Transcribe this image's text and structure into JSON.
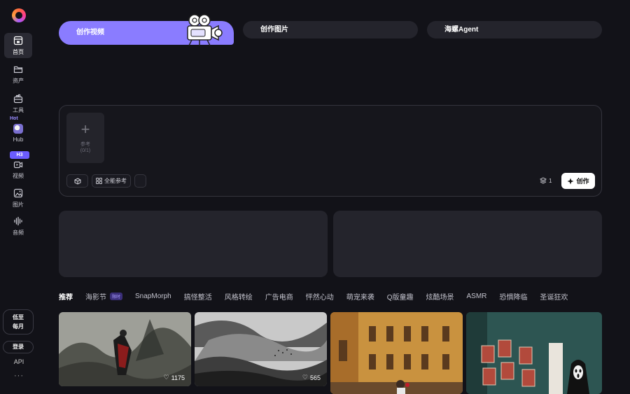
{
  "sidebar": {
    "items": [
      {
        "label": "首页",
        "icon": "home-icon"
      },
      {
        "label": "资产",
        "icon": "folder-icon"
      },
      {
        "label": "工具",
        "icon": "toolbox-icon"
      },
      {
        "label": "Hub",
        "icon": "hub-avatar-icon",
        "badge": "Hot"
      },
      {
        "label": "视频",
        "icon": "video-icon",
        "badge": "H3"
      },
      {
        "label": "图片",
        "icon": "image-icon"
      },
      {
        "label": "音频",
        "icon": "audio-icon"
      }
    ],
    "promo_line1": "低至",
    "promo_line2": "每月",
    "login": "登录",
    "api": "API",
    "more": "···"
  },
  "modes": {
    "video": "创作视频",
    "image": "创作图片",
    "agent": "海螺Agent"
  },
  "prompt": {
    "ref_label": "参考",
    "ref_count": "(0/1)",
    "omni_ref": "全能参考",
    "count": "1",
    "create": "创作"
  },
  "categories": [
    {
      "label": "推荐",
      "active": true
    },
    {
      "label": "海影节",
      "badge": "限时"
    },
    {
      "label": "SnapMorph"
    },
    {
      "label": "搞怪整活"
    },
    {
      "label": "风格转绘"
    },
    {
      "label": "广告电商"
    },
    {
      "label": "怦然心动"
    },
    {
      "label": "萌宠来袭"
    },
    {
      "label": "Q版童趣"
    },
    {
      "label": "炫酷场景"
    },
    {
      "label": "ASMR"
    },
    {
      "label": "恐惧降临"
    },
    {
      "label": "圣诞狂欢"
    }
  ],
  "gallery": [
    {
      "likes": "1175"
    },
    {
      "likes": "565"
    },
    {},
    {}
  ],
  "colors": {
    "accent": "#8a7cff",
    "background": "#121218",
    "panel": "#24242c"
  }
}
